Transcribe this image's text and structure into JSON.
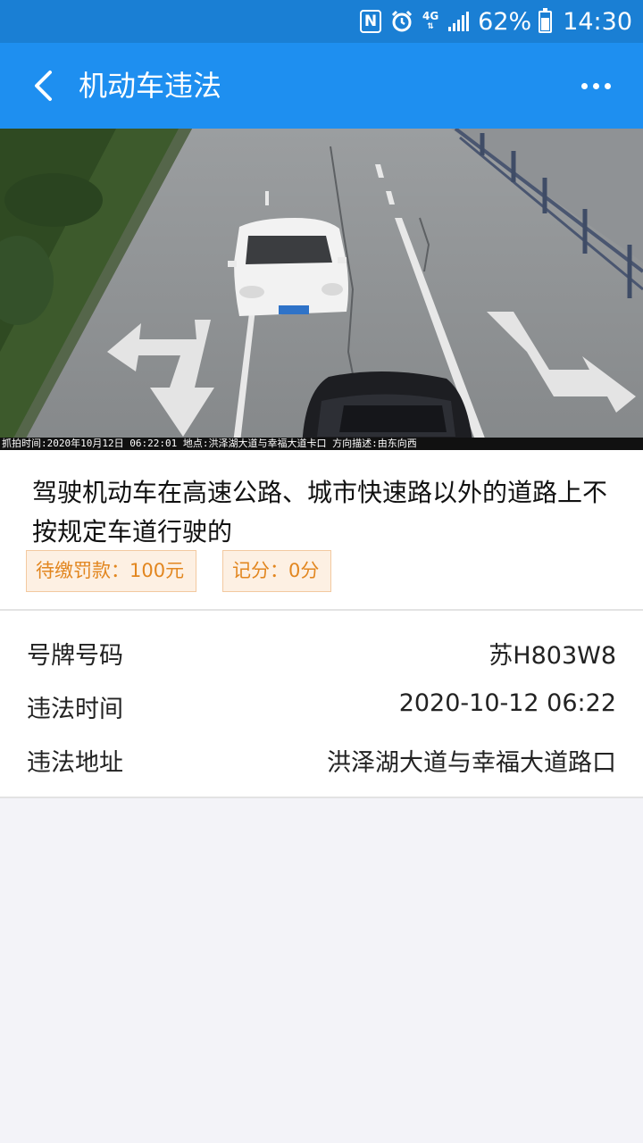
{
  "status_bar": {
    "network": "4G",
    "battery": "62%",
    "time": "14:30",
    "icons": [
      "nfc-icon",
      "alarm-icon",
      "signal-icon",
      "battery-icon"
    ]
  },
  "app_bar": {
    "title": "机动车违法",
    "back_icon": "chevron-left-icon",
    "more_icon": "more-dots-icon"
  },
  "photo": {
    "caption": "抓拍时间:2020年10月12日 06:22:01 地点:洪泽湖大道与幸福大道卡口 方向描述:由东向西",
    "plate_text": "苏H803W8"
  },
  "violation": {
    "description": "驾驶机动车在高速公路、城市快速路以外的道路上不按规定车道行驶的",
    "fine_label": "待缴罚款：100元",
    "points_label": "记分：0分"
  },
  "details": [
    {
      "label": "号牌号码",
      "value": "苏H803W8"
    },
    {
      "label": "违法时间",
      "value": "2020-10-12 06:22"
    },
    {
      "label": "违法地址",
      "value": "洪泽湖大道与幸福大道路口"
    }
  ],
  "colors": {
    "status_bar": "#1a7fd4",
    "app_bar": "#1e8ff0",
    "tag_text": "#e2861f",
    "tag_bg": "#fdf0e3",
    "page_bg": "#f3f3f8"
  }
}
